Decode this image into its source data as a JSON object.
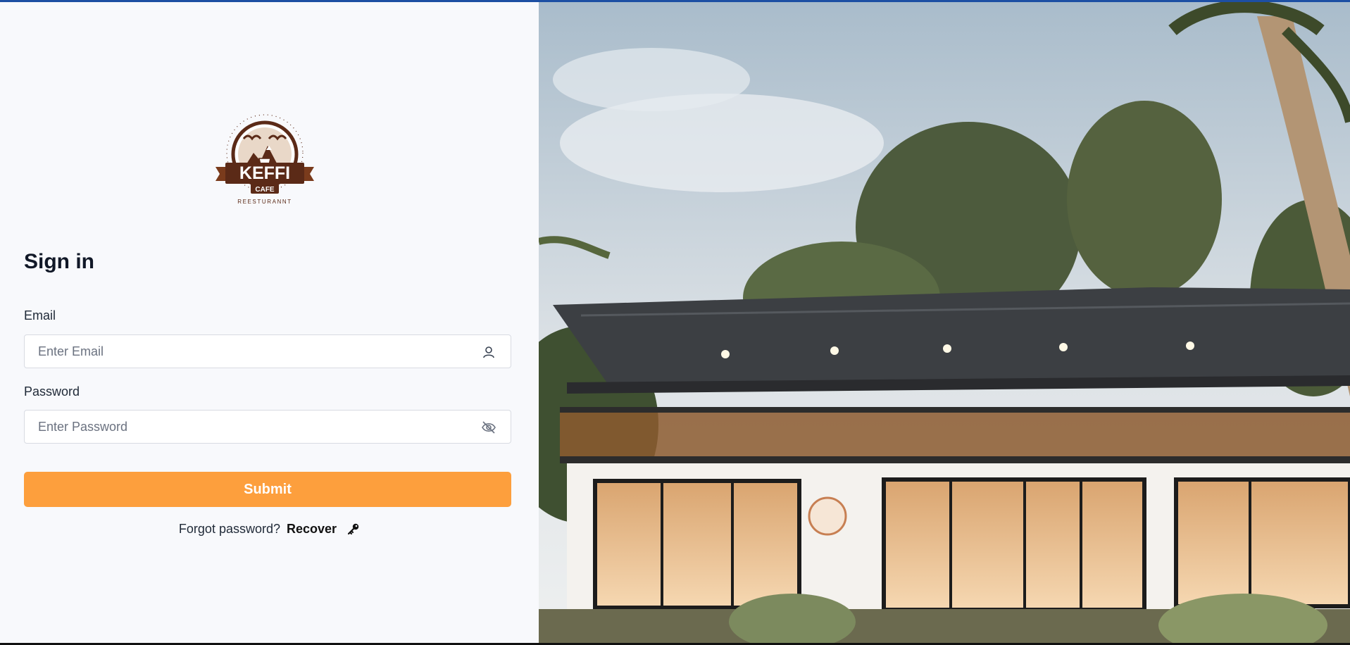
{
  "logo": {
    "brand": "KEFFI",
    "sub": "CAFE",
    "tagline": "REESTURANNT"
  },
  "form": {
    "title": "Sign in",
    "email_label": "Email",
    "email_placeholder": "Enter Email",
    "password_label": "Password",
    "password_placeholder": "Enter Password",
    "submit_label": "Submit",
    "forgot_text": "Forgot password?",
    "recover_label": "Recover"
  },
  "icons": {
    "email": "user-icon",
    "password": "eye-off-icon",
    "recover": "key-icon"
  },
  "colors": {
    "accent": "#fd9f3d",
    "top_bar": "#1d4fa3",
    "logo_brown": "#5b2a17"
  }
}
